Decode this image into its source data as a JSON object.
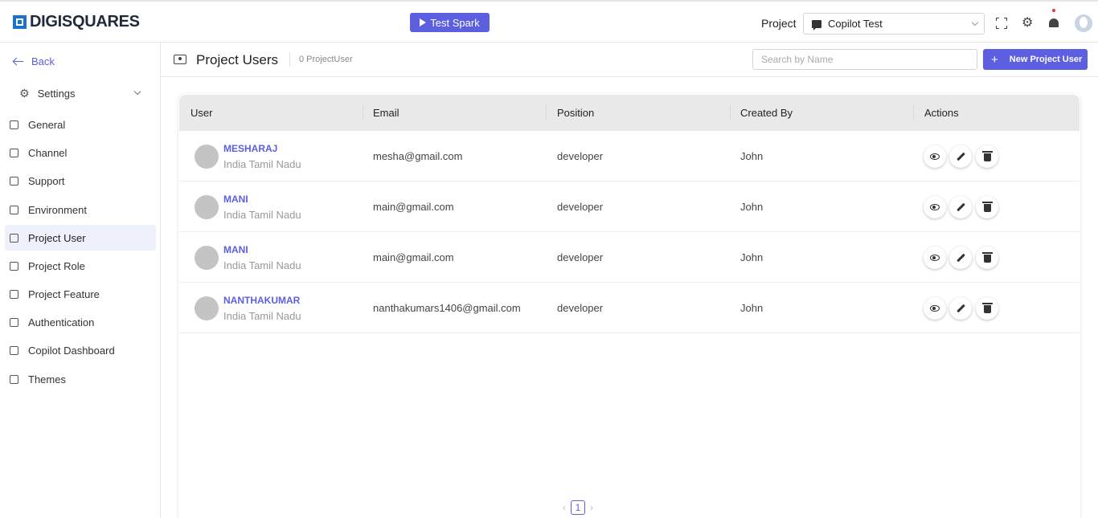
{
  "header": {
    "logo_text": "DIGISQUARES",
    "test_button": "Test Spark",
    "project_label": "Project",
    "project_selected": "Copilot Test"
  },
  "sidebar": {
    "back_label": "Back",
    "settings_label": "Settings",
    "items": [
      {
        "label": "General",
        "icon": "document-icon"
      },
      {
        "label": "Channel",
        "icon": "monitor-icon"
      },
      {
        "label": "Support",
        "icon": "lifebuoy-icon"
      },
      {
        "label": "Environment",
        "icon": "sliders-icon"
      },
      {
        "label": "Project User",
        "icon": "user-card-icon"
      },
      {
        "label": "Project Role",
        "icon": "role-icon"
      },
      {
        "label": "Project Feature",
        "icon": "feature-icon"
      },
      {
        "label": "Authentication",
        "icon": "fingerprint-icon"
      },
      {
        "label": "Copilot Dashboard",
        "icon": "dashboard-icon"
      },
      {
        "label": "Themes",
        "icon": "palette-icon"
      }
    ],
    "active_index": 4
  },
  "main": {
    "title": "Project Users",
    "count_text": "0 ProjectUser",
    "search_placeholder": "Search by Name",
    "new_button": "New Project User",
    "new_button_plus": "+"
  },
  "table": {
    "columns": [
      "User",
      "Email",
      "Position",
      "Created By",
      "Actions"
    ],
    "rows": [
      {
        "name": "MESHARAJ",
        "location": "India Tamil Nadu",
        "email": "mesha@gmail.com",
        "position": "developer",
        "created_by": "John"
      },
      {
        "name": "MANI",
        "location": "India Tamil Nadu",
        "email": "main@gmail.com",
        "position": "developer",
        "created_by": "John"
      },
      {
        "name": "MANI",
        "location": "India Tamil Nadu",
        "email": "main@gmail.com",
        "position": "developer",
        "created_by": "John"
      },
      {
        "name": "NANTHAKUMAR",
        "location": "India Tamil Nadu",
        "email": "nanthakumars1406@gmail.com",
        "position": "developer",
        "created_by": "John"
      }
    ]
  },
  "pagination": {
    "prev": "‹",
    "current": "1",
    "next": "›"
  },
  "colors": {
    "accent": "#5b5fe0",
    "logo_blue": "#1a73c8",
    "notification_dot": "#e53935"
  }
}
